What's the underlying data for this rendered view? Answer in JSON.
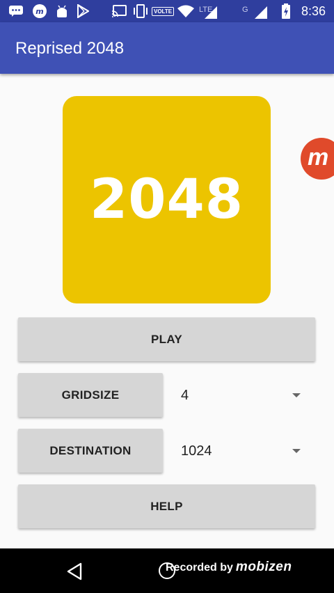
{
  "status_bar": {
    "time": "8:36",
    "volte": "VOLTE",
    "network_lte": "LTE",
    "network_g": "G",
    "icons": [
      "chat-bubble-icon",
      "mobizen-notification-icon",
      "android-debug-icon",
      "play-store-icon",
      "cast-icon",
      "vibrate-icon",
      "wifi-icon",
      "signal-icon",
      "battery-charging-icon"
    ]
  },
  "app_bar": {
    "title": "Reprised 2048"
  },
  "logo": {
    "text": "2048",
    "color": "#ecc400"
  },
  "buttons": {
    "play": "PLAY",
    "gridsize": "GRIDSIZE",
    "destination": "DESTINATION",
    "help": "HELP"
  },
  "spinners": {
    "gridsize_value": "4",
    "destination_value": "1024"
  },
  "overlay": {
    "bubble_letter": "m",
    "recorded_by": "Recorded by",
    "brand": "mobizen"
  },
  "colors": {
    "app_bar": "#3f51b5",
    "status_bar": "#2f3e9e",
    "button": "#d6d6d6",
    "bubble": "#e04a2b"
  }
}
